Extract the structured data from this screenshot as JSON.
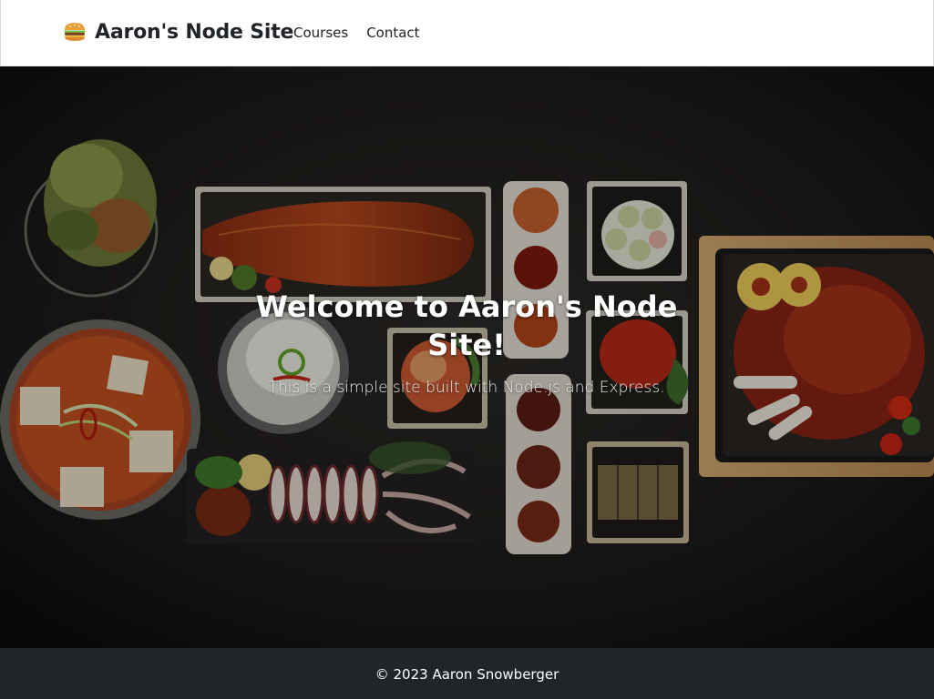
{
  "navbar": {
    "brand_icon": "burger-icon",
    "brand_text": "Aaron's Node Site",
    "links": [
      {
        "label": "Courses"
      },
      {
        "label": "Contact"
      }
    ]
  },
  "hero": {
    "title": "Welcome to Aaron's Node Site!",
    "subtitle": "This is a simple site built with Node.js and Express.",
    "image": "food-spread-background"
  },
  "footer": {
    "text": "© 2023 Aaron Snowberger"
  },
  "colors": {
    "navbar_bg": "#ffffff",
    "text_dark": "#212529",
    "footer_bg": "#212529",
    "hero_bg": "#1f1d1b"
  }
}
